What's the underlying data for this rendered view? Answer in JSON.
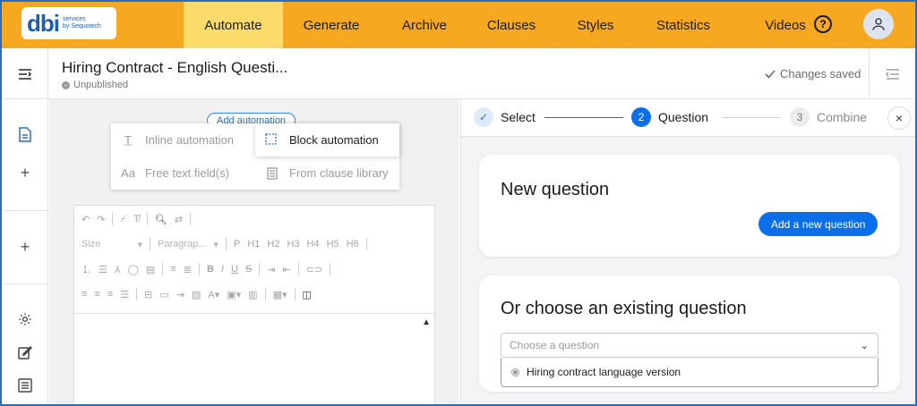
{
  "brand": {
    "logo_main": "dbi",
    "logo_sub_1": "services",
    "logo_sub_2": "by Sequotech",
    "accent": "#f6a821",
    "active_tab": "#fbdc6a",
    "primary": "#0a6fe8"
  },
  "nav": {
    "items": [
      {
        "label": "Automate",
        "active": true
      },
      {
        "label": "Generate",
        "active": false
      },
      {
        "label": "Archive",
        "active": false
      },
      {
        "label": "Clauses",
        "active": false
      },
      {
        "label": "Styles",
        "active": false
      },
      {
        "label": "Statistics",
        "active": false
      },
      {
        "label": "Videos",
        "active": false
      }
    ],
    "help_icon": "question-circle-icon",
    "avatar_icon": "user-icon"
  },
  "header": {
    "doc_title": "Hiring Contract - English Questi...",
    "status": "Unpublished",
    "saved": "Changes saved"
  },
  "editor": {
    "add_automation": "Add automation",
    "menu": {
      "inline": "Inline automation",
      "block": "Block automation",
      "free_text": "Free text field(s)",
      "clause_library": "From clause library"
    },
    "toolbar": {
      "size": "Size",
      "paragraph": "Paragrap...",
      "headings": [
        "P",
        "H1",
        "H2",
        "H3",
        "H4",
        "H5",
        "H6"
      ],
      "format_buttons": [
        "B",
        "I",
        "U",
        "S"
      ]
    }
  },
  "stepper": {
    "steps": [
      {
        "number": "✓",
        "label": "Select",
        "state": "done"
      },
      {
        "number": "2",
        "label": "Question",
        "state": "active"
      },
      {
        "number": "3",
        "label": "Combine",
        "state": "todo"
      }
    ],
    "close": "×"
  },
  "new_question": {
    "title": "New question",
    "button": "Add a new question"
  },
  "existing_question": {
    "title": "Or choose an existing question",
    "placeholder": "Choose a question",
    "options": [
      "Hiring contract language version"
    ]
  }
}
